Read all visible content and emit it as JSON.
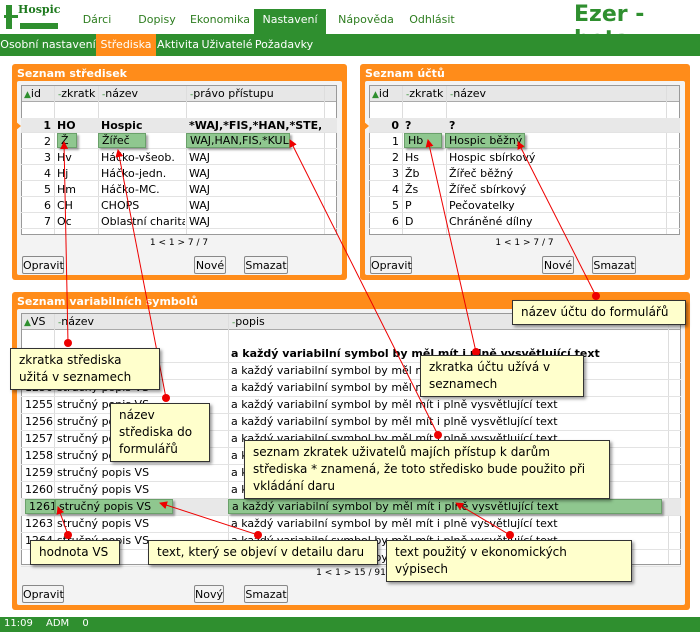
{
  "header": {
    "logo_text": "Hospic",
    "app_title": "Ezer - beta",
    "menu": [
      "Dárci",
      "Dopisy",
      "Ekonomika",
      "Nastavení",
      "Nápověda",
      "Odhlásit"
    ]
  },
  "submenu": [
    "Osobní nastavení",
    "Střediska",
    "Aktivita",
    "Uživatelé",
    "Požadavky"
  ],
  "strediska": {
    "title": "Seznam středisek",
    "columns": [
      "id",
      "zkratk",
      "název",
      "právo přístupu"
    ],
    "rows": [
      {
        "id": "1",
        "zkratka": "HO",
        "nazev": "Hospic",
        "pravo": "*WAJ,*FIS,*HAN,*STE,*SMI"
      },
      {
        "id": "2",
        "zkratka": "Ž",
        "nazev": "Žířeč",
        "pravo": "WAJ,HAN,FIS,*KUL"
      },
      {
        "id": "3",
        "zkratka": "Hv",
        "nazev": "Háčko-všeob.",
        "pravo": "WAJ"
      },
      {
        "id": "4",
        "zkratka": "Hj",
        "nazev": "Háčko-jedn.",
        "pravo": "WAJ"
      },
      {
        "id": "5",
        "zkratka": "Hm",
        "nazev": "Háčko-MC.",
        "pravo": "WAJ"
      },
      {
        "id": "6",
        "zkratka": "CH",
        "nazev": "CHOPS",
        "pravo": "WAJ"
      },
      {
        "id": "7",
        "zkratka": "Oc",
        "nazev": "Oblastní charita",
        "pravo": "WAJ"
      }
    ],
    "pager": "1 < 1 > 7 / 7",
    "buttons": {
      "opravit": "Opravit",
      "nove": "Nové",
      "smazat": "Smazat"
    }
  },
  "ucty": {
    "title": "Seznam účtů",
    "columns": [
      "id",
      "zkratk",
      "název"
    ],
    "rows": [
      {
        "id": "0",
        "zkratka": "?",
        "nazev": "?"
      },
      {
        "id": "1",
        "zkratka": "Hb",
        "nazev": "Hospic běžný"
      },
      {
        "id": "2",
        "zkratka": "Hs",
        "nazev": "Hospic sbírkový"
      },
      {
        "id": "3",
        "zkratka": "Žb",
        "nazev": "Žířeč běžný"
      },
      {
        "id": "4",
        "zkratka": "Žs",
        "nazev": "Žířeč sbírkový"
      },
      {
        "id": "5",
        "zkratka": "P",
        "nazev": "Pečovatelky"
      },
      {
        "id": "6",
        "zkratka": "D",
        "nazev": "Chráněné dílny"
      }
    ],
    "pager": "1 < 1 > 7 / 7",
    "buttons": {
      "opravit": "Opravit",
      "nove": "Nové",
      "smazat": "Smazat"
    }
  },
  "vs": {
    "title": "Seznam variabilních symbolů",
    "columns": [
      "VS",
      "název",
      "popis"
    ],
    "first_popis": "a každý variabilní symbol by měl mít i plně vysvětlující text",
    "rows": [
      {
        "vs": "",
        "nazev": "",
        "popis": "a každý variabilní symbol by měl mít i plně vysvětlující text"
      },
      {
        "vs": "",
        "nazev": "",
        "popis": "a každý variabilní symbol by měl mít i plně vysvětlující text"
      },
      {
        "vs": "1250",
        "nazev": "stručný popis VS",
        "popis": "a každý variabilní symbol by měl mít i plně vysvětlující text"
      },
      {
        "vs": "1255",
        "nazev": "stručný popis VS",
        "popis": "a každý variabilní symbol by měl mít i plně vysvětlující text"
      },
      {
        "vs": "1256",
        "nazev": "stručný popis VS",
        "popis": "a každý variabilní symbol by měl mít i plně vysvětlující text"
      },
      {
        "vs": "1257",
        "nazev": "stručný popis VS",
        "popis": "a každý variabilní symbol by měl mít i plně vysvětlující text"
      },
      {
        "vs": "1258",
        "nazev": "stručný popis VS",
        "popis": "a každý variabilní symbol by měl mít i plně vysvětlující text"
      },
      {
        "vs": "1259",
        "nazev": "stručný popis VS",
        "popis": "a každý variabilní symbol by měl mít i plně vysvětlující text"
      },
      {
        "vs": "1260",
        "nazev": "stručný popis VS",
        "popis": "a každý variabilní symbol by měl mít i plně vysvětlující text"
      },
      {
        "vs": "1261",
        "nazev": "stručný popis VS",
        "popis": "a každý variabilní symbol by měl mít i plně vysvětlující text"
      },
      {
        "vs": "1263",
        "nazev": "stručný popis VS",
        "popis": "a každý variabilní symbol by měl mít i plně vysvětlující text"
      },
      {
        "vs": "1264",
        "nazev": "stručný popis VS",
        "popis": "a každý variabilní symbol by měl mít i plně vysvětlující text"
      },
      {
        "vs": "",
        "nazev": "",
        "popis": "a každý variabilní symbol by měl mít i plně vysvětlující text"
      }
    ],
    "pager": "1 < 1 > 15 / 91",
    "buttons": {
      "opravit": "Opravit",
      "nove": "Nový",
      "smazat": "Smazat"
    }
  },
  "callouts": {
    "c1": "zkratka střediska užitá v seznamech",
    "c2": "název střediska do formulářů",
    "c3": "hodnota VS",
    "c4": "text, který se objeví v detailu daru",
    "c5": "seznam zkratek uživatelů majích přístup k darům střediska * znamená, že toto středisko bude použito při vkládání daru",
    "c6": "zkratka účtu užívá v seznamech",
    "c7": "název účtu do formulářů",
    "c8": "text použitý v ekonomických výpisech"
  },
  "statusbar": {
    "time": "11:09",
    "user": "ADM",
    "count": "0"
  },
  "colors": {
    "green": "#2f8f2f",
    "orange": "#ff8c1a",
    "callout": "#ffffcc",
    "arrow": "#e00000"
  }
}
